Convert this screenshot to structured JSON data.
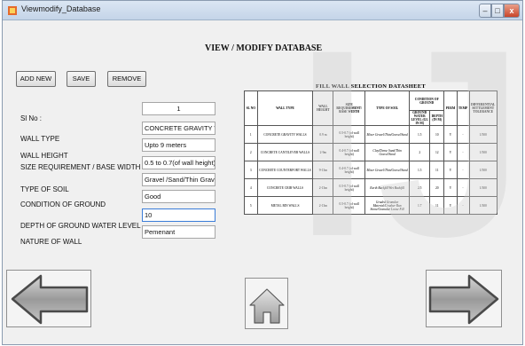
{
  "window": {
    "title": "Viewmodify_Database",
    "controls": {
      "minimize": "–",
      "maximize": "□",
      "close": "x"
    }
  },
  "form": {
    "heading": "VIEW / MODIFY DATABASE"
  },
  "toolbar": {
    "add_label": "ADD NEW",
    "save_label": "SAVE",
    "remove_label": "REMOVE"
  },
  "labels": {
    "sl_no": "Sl No :",
    "wall_type": "WALL TYPE",
    "wall_height": "WALL HEIGHT",
    "size_req": "SIZE REQUIREMENT / BASE WIDTH",
    "soil_type": "TYPE OF SOIL",
    "ground_condition": "CONDITION OF GROUND",
    "water_depth": "DEPTH OF GROUND WATER LEVEL",
    "nature": "NATURE OF WALL"
  },
  "fields": {
    "sl_no": "1",
    "wall_type": "CONCRETE GRAVITY WALL",
    "wall_height": "Upto 9 meters",
    "size_req": "0.5 to 0.7(of wall height)",
    "soil_type": "Gravel /Sand/Thin Gravel",
    "ground_condition": "Good",
    "water_depth": "10",
    "nature": "Pemenant"
  },
  "datasheet": {
    "title": "FILL WALL SELECTION DATASHEET",
    "headers": [
      "SL NO",
      "WALL TYPE",
      "WALL HEIGHT",
      "SIZE REQUIREMENT/ BASE WIDTH",
      "TYPE OF SOIL",
      "CONDITION OF GROUND",
      "PERM",
      "TEMP",
      "DIFFERENTIAL SETTLEMENT TOLERANCE"
    ],
    "subheaders": {
      "ground_water": "GROUND WATER LEVEL (GL IN M)",
      "depth": "DEPTH (IN M)"
    },
    "rows": [
      {
        "sl": "1",
        "type": "CONCRETE GRAVITY WALLS",
        "height": "0.9 m",
        "size": "0.5-0.7 (of wall height)",
        "soil": "Mixer Gravel/Thin/Gravel/Sand",
        "gw": "1.5",
        "depth": "10",
        "perm": "Y",
        "temp": "-",
        "tol": "1/500"
      },
      {
        "sl": "2",
        "type": "CONCRETE CANTILEVER WALLS",
        "height": "2-9m",
        "size": "0.4-0.7 (of wall height)",
        "soil": "Clay/Dense Sand/Thin Gravel/Sand",
        "gw": "2",
        "depth": "12",
        "perm": "Y",
        "temp": "-",
        "tol": "1/500"
      },
      {
        "sl": "3",
        "type": "CONCRETE COUNTERFORT WALLS",
        "height": "9-13m",
        "size": "0.4-0.7 (of wall height)",
        "soil": "Mixer Gravel/Thin/Gravel/Sand",
        "gw": "1.5",
        "depth": "11",
        "perm": "Y",
        "temp": "-",
        "tol": "1/500"
      },
      {
        "sl": "4",
        "type": "CONCRETE CRIB WALLS",
        "height": "2-13m",
        "size": "0.5-0.7 (of wall height)",
        "soil": "Earth Backfill/Wet Backfill",
        "gw": "2.5",
        "depth": "20",
        "perm": "Y",
        "temp": "-",
        "tol": "1/300"
      },
      {
        "sl": "5",
        "type": "METAL BIN WALLS",
        "height": "2-13m",
        "size": "0.5-0.7 (of wall height)",
        "soil": "Graded Granular Material/Crusher Run Stone/Granular Loose Fill",
        "gw": "1.7",
        "depth": "11",
        "perm": "Y",
        "temp": "-",
        "tol": "1/300"
      }
    ]
  },
  "icons": {
    "prev": "left-arrow-icon",
    "home": "home-icon",
    "next": "right-arrow-icon"
  },
  "colors": {
    "arrow_fill": "#9a9a9a",
    "arrow_stroke": "#4a4a4a",
    "title_bar": "#c4d4e8"
  }
}
